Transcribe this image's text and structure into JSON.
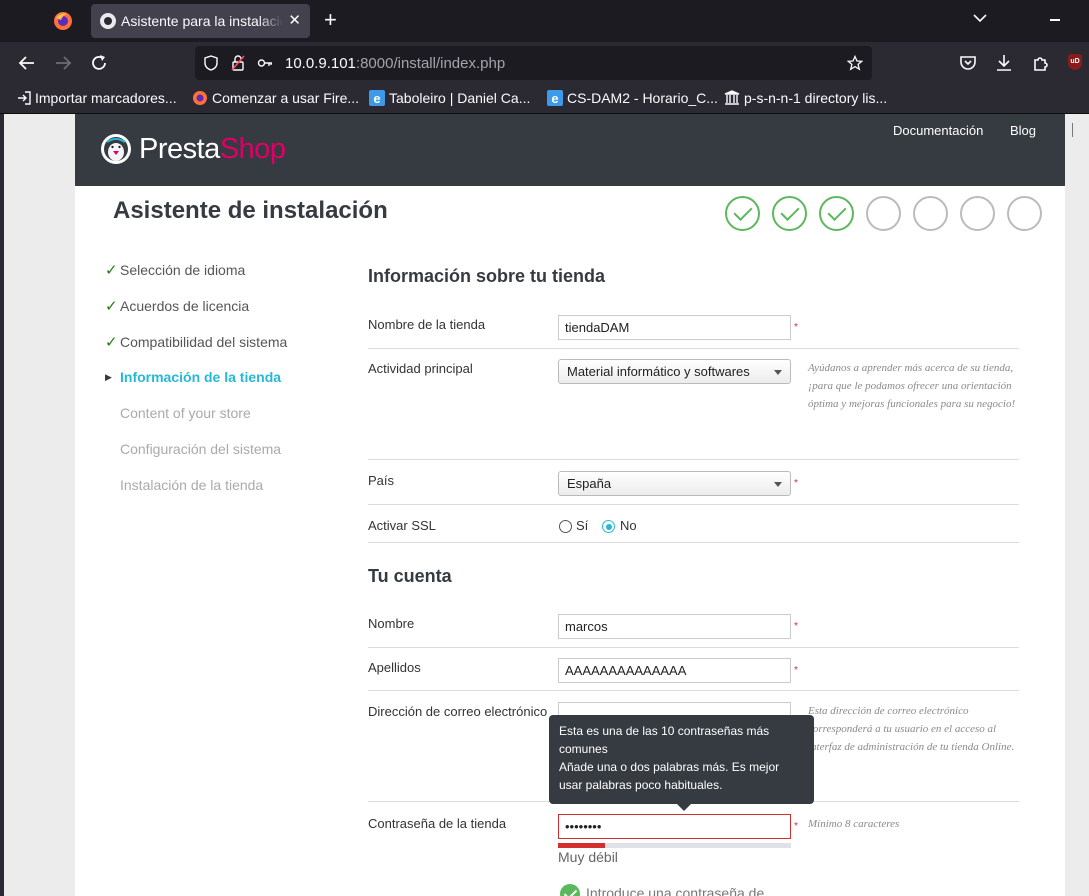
{
  "browser": {
    "tab_title": "Asistente para la instalación",
    "url_host": "10.0.9.101",
    "url_rest": ":8000/install/index.php",
    "bookmarks": [
      {
        "label": "Importar marcadores...",
        "icon": "import-icon"
      },
      {
        "label": "Comenzar a usar Fire...",
        "icon": "firefox-icon"
      },
      {
        "label": "Taboleiro | Daniel Ca...",
        "icon": "edge-icon"
      },
      {
        "label": "CS-DAM2 - Horario_C...",
        "icon": "edge-icon"
      },
      {
        "label": "p-s-n-n-1 directory lis...",
        "icon": "archive-icon"
      }
    ]
  },
  "header": {
    "logo_presta": "Presta",
    "logo_shop": "Shop",
    "doc_link": "Documentación",
    "blog_link": "Blog"
  },
  "wizard": {
    "title": "Asistente de instalación",
    "steps_done": 3,
    "steps_total": 7
  },
  "sidebar": {
    "items": [
      {
        "label": "Selección de idioma",
        "state": "done"
      },
      {
        "label": "Acuerdos de licencia",
        "state": "done"
      },
      {
        "label": "Compatibilidad del sistema",
        "state": "done"
      },
      {
        "label": "Información de la tienda",
        "state": "active"
      },
      {
        "label": "Content of your store",
        "state": "future"
      },
      {
        "label": "Configuración del sistema",
        "state": "future"
      },
      {
        "label": "Instalación de la tienda",
        "state": "future"
      }
    ]
  },
  "store": {
    "section_title": "Información sobre tu tienda",
    "name_label": "Nombre de la tienda",
    "name_value": "tiendaDAM",
    "activity_label": "Actividad principal",
    "activity_value": "Material informático y softwares",
    "activity_help": "Ayúdanos a aprender más acerca de su tienda, ¡para que le podamos ofrecer una orientación óptima y mejoras funcionales para su negocio!",
    "country_label": "País",
    "country_value": "España",
    "ssl_label": "Activar SSL",
    "ssl_yes": "Sí",
    "ssl_no": "No",
    "ssl_selected": "No"
  },
  "account": {
    "section_title": "Tu cuenta",
    "first_name_label": "Nombre",
    "first_name_value": "marcos",
    "last_name_label": "Apellidos",
    "last_name_value": "AAAAAAAAAAAAAA",
    "email_label": "Dirección de correo electrónico",
    "email_help": "Esta dirección de correo electrónico corresponderá a tu usuario en el acceso al interfaz de administración de tu tienda Online.",
    "password_label": "Contraseña de la tienda",
    "password_value": "••••••••",
    "password_help": "Mínimo 8 caracteres",
    "password_strength": "Muy débil",
    "password_strength_fraction": 0.2,
    "password_hint": "Introduce una contraseña de",
    "tooltip_line1": "Esta es una de las 10 contraseñas más comunes",
    "tooltip_line2": "Añade una o dos palabras más. Es mejor usar palabras poco habituales."
  },
  "required_mark": "*",
  "colors": {
    "header_bg": "#363a41",
    "shop_pink": "#df0067",
    "active_cyan": "#25b9d7",
    "success_green": "#5cb85c",
    "error_red": "#d32f2f"
  }
}
